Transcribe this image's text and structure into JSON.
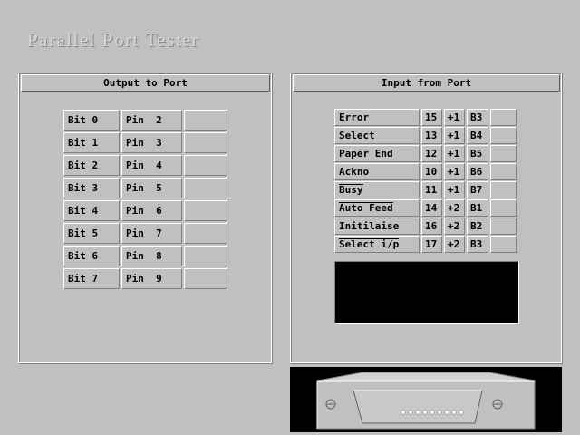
{
  "app": {
    "title": "Parallel Port Tester"
  },
  "output_panel": {
    "title": "Output to Port",
    "rows": [
      {
        "bit": "Bit 0",
        "pin": "Pin  2",
        "state": ""
      },
      {
        "bit": "Bit 1",
        "pin": "Pin  3",
        "state": ""
      },
      {
        "bit": "Bit 2",
        "pin": "Pin  4",
        "state": ""
      },
      {
        "bit": "Bit 3",
        "pin": "Pin  5",
        "state": ""
      },
      {
        "bit": "Bit 4",
        "pin": "Pin  6",
        "state": ""
      },
      {
        "bit": "Bit 5",
        "pin": "Pin  7",
        "state": ""
      },
      {
        "bit": "Bit 6",
        "pin": "Pin  8",
        "state": ""
      },
      {
        "bit": "Bit 7",
        "pin": "Pin  9",
        "state": ""
      }
    ]
  },
  "input_panel": {
    "title": "Input from Port",
    "rows": [
      {
        "name": "Error",
        "pin": "15",
        "offset": "+1",
        "bit": "B3",
        "state": "",
        "inverted": false
      },
      {
        "name": "Select",
        "pin": "13",
        "offset": "+1",
        "bit": "B4",
        "state": "",
        "inverted": false
      },
      {
        "name": "Paper End",
        "pin": "12",
        "offset": "+1",
        "bit": "B5",
        "state": "",
        "inverted": false
      },
      {
        "name": "Ackno",
        "pin": "10",
        "offset": "+1",
        "bit": "B6",
        "state": "",
        "inverted": false
      },
      {
        "name": "Busy",
        "pin": "11",
        "offset": "+1",
        "bit": "B7",
        "state": "",
        "inverted": true
      },
      {
        "name": "Auto Feed",
        "pin": "14",
        "offset": "+2",
        "bit": "B1",
        "state": "",
        "inverted": true
      },
      {
        "name": "Initilaise",
        "pin": "16",
        "offset": "+2",
        "bit": "B2",
        "state": "",
        "inverted": false
      },
      {
        "name": "Select i/p",
        "pin": "17",
        "offset": "+2",
        "bit": "B3",
        "state": "",
        "inverted": true
      }
    ],
    "display": {
      "text": ""
    }
  },
  "connector": {
    "icon": "db25-connector-icon"
  }
}
